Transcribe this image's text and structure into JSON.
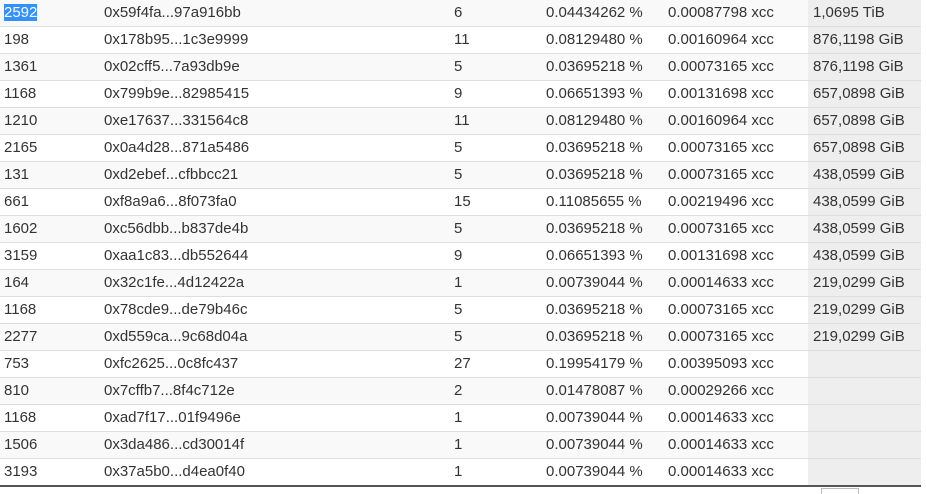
{
  "table": {
    "rows": [
      {
        "id": "2592",
        "address": "0x59f4fa...97a916bb",
        "count": "6",
        "percent": "0.04434262 %",
        "xcc": "0.00087798 xcc",
        "size": "1,0695 TiB"
      },
      {
        "id": "198",
        "address": "0x178b95...1c3e9999",
        "count": "11",
        "percent": "0.08129480 %",
        "xcc": "0.00160964 xcc",
        "size": "876,1198 GiB"
      },
      {
        "id": "1361",
        "address": "0x02cff5...7a93db9e",
        "count": "5",
        "percent": "0.03695218 %",
        "xcc": "0.00073165 xcc",
        "size": "876,1198 GiB"
      },
      {
        "id": "1168",
        "address": "0x799b9e...82985415",
        "count": "9",
        "percent": "0.06651393 %",
        "xcc": "0.00131698 xcc",
        "size": "657,0898 GiB"
      },
      {
        "id": "1210",
        "address": "0xe17637...331564c8",
        "count": "11",
        "percent": "0.08129480 %",
        "xcc": "0.00160964 xcc",
        "size": "657,0898 GiB"
      },
      {
        "id": "2165",
        "address": "0x0a4d28...871a5486",
        "count": "5",
        "percent": "0.03695218 %",
        "xcc": "0.00073165 xcc",
        "size": "657,0898 GiB"
      },
      {
        "id": "131",
        "address": "0xd2ebef...cfbbcc21",
        "count": "5",
        "percent": "0.03695218 %",
        "xcc": "0.00073165 xcc",
        "size": "438,0599 GiB"
      },
      {
        "id": "661",
        "address": "0xf8a9a6...8f073fa0",
        "count": "15",
        "percent": "0.11085655 %",
        "xcc": "0.00219496 xcc",
        "size": "438,0599 GiB"
      },
      {
        "id": "1602",
        "address": "0xc56dbb...b837de4b",
        "count": "5",
        "percent": "0.03695218 %",
        "xcc": "0.00073165 xcc",
        "size": "438,0599 GiB"
      },
      {
        "id": "3159",
        "address": "0xaa1c83...db552644",
        "count": "9",
        "percent": "0.06651393 %",
        "xcc": "0.00131698 xcc",
        "size": "438,0599 GiB"
      },
      {
        "id": "164",
        "address": "0x32c1fe...4d12422a",
        "count": "1",
        "percent": "0.00739044 %",
        "xcc": "0.00014633 xcc",
        "size": "219,0299 GiB"
      },
      {
        "id": "1168",
        "address": "0x78cde9...de79b46c",
        "count": "5",
        "percent": "0.03695218 %",
        "xcc": "0.00073165 xcc",
        "size": "219,0299 GiB"
      },
      {
        "id": "2277",
        "address": "0xd559ca...9c68d04a",
        "count": "5",
        "percent": "0.03695218 %",
        "xcc": "0.00073165 xcc",
        "size": "219,0299 GiB"
      },
      {
        "id": "753",
        "address": "0xfc2625...0c8fc437",
        "count": "27",
        "percent": "0.19954179 %",
        "xcc": "0.00395093 xcc",
        "size": ""
      },
      {
        "id": "810",
        "address": "0x7cffb7...8f4c712e",
        "count": "2",
        "percent": "0.01478087 %",
        "xcc": "0.00029266 xcc",
        "size": ""
      },
      {
        "id": "1168",
        "address": "0xad7f17...01f9496e",
        "count": "1",
        "percent": "0.00739044 %",
        "xcc": "0.00014633 xcc",
        "size": ""
      },
      {
        "id": "1506",
        "address": "0x3da486...cd30014f",
        "count": "1",
        "percent": "0.00739044 %",
        "xcc": "0.00014633 xcc",
        "size": ""
      },
      {
        "id": "3193",
        "address": "0x37a5b0...d4ea0f40",
        "count": "1",
        "percent": "0.00739044 %",
        "xcc": "0.00014633 xcc",
        "size": ""
      }
    ]
  },
  "colors": {
    "selection_highlight": "#3390ff",
    "row_border": "#dddddd",
    "size_column_bg": "#eeeeee"
  }
}
